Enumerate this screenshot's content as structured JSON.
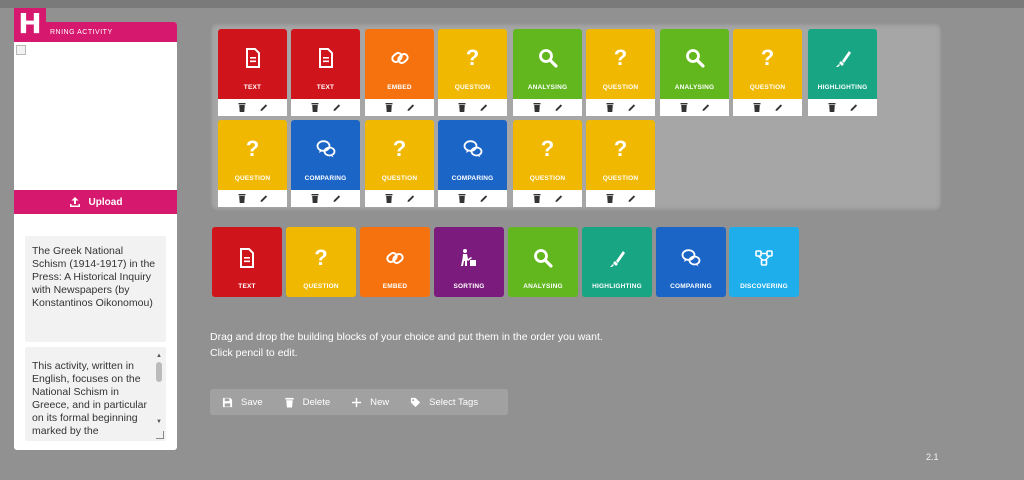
{
  "app": {
    "logo_letter": "H",
    "header_text": "RNING ACTIVITY",
    "version": "2.1"
  },
  "upload": {
    "label": "Upload"
  },
  "activity": {
    "title": "The Greek National Schism (1914-1917) in the Press: A Historical Inquiry with Newspapers (by Konstantinos Oikonomou)",
    "description": "This activity, written in English, focuses on the National Schism in Greece, and in particular on its formal beginning marked by the"
  },
  "sequence": [
    {
      "type": "TEXT",
      "color": "red",
      "icon": "document-icon"
    },
    {
      "type": "TEXT",
      "color": "red",
      "icon": "document-icon"
    },
    {
      "type": "EMBED",
      "color": "orange",
      "icon": "link-icon"
    },
    {
      "type": "QUESTION",
      "color": "yellow",
      "icon": "question-icon"
    },
    {
      "type": "ANALYSING",
      "color": "green",
      "icon": "magnifier-icon"
    },
    {
      "type": "QUESTION",
      "color": "yellow",
      "icon": "question-icon"
    },
    {
      "type": "ANALYSING",
      "color": "green",
      "icon": "magnifier-icon"
    },
    {
      "type": "QUESTION",
      "color": "yellow",
      "icon": "question-icon"
    },
    {
      "type": "HIGHLIGHTING",
      "color": "teal",
      "icon": "highlighter-icon"
    },
    {
      "type": "QUESTION",
      "color": "yellow",
      "icon": "question-icon"
    },
    {
      "type": "COMPARING",
      "color": "blue",
      "icon": "speech-bubbles-icon"
    },
    {
      "type": "QUESTION",
      "color": "yellow",
      "icon": "question-icon"
    },
    {
      "type": "COMPARING",
      "color": "blue",
      "icon": "speech-bubbles-icon"
    },
    {
      "type": "QUESTION",
      "color": "yellow",
      "icon": "question-icon"
    },
    {
      "type": "QUESTION",
      "color": "yellow",
      "icon": "question-icon"
    }
  ],
  "palette": [
    {
      "type": "TEXT",
      "color": "red",
      "icon": "document-icon"
    },
    {
      "type": "QUESTION",
      "color": "yellow",
      "icon": "question-icon"
    },
    {
      "type": "EMBED",
      "color": "orange",
      "icon": "link-icon"
    },
    {
      "type": "SORTING",
      "color": "purple",
      "icon": "sorting-icon"
    },
    {
      "type": "ANALYSING",
      "color": "green",
      "icon": "magnifier-icon"
    },
    {
      "type": "HIGHLIGHTING",
      "color": "teal",
      "icon": "highlighter-icon"
    },
    {
      "type": "COMPARING",
      "color": "blue",
      "icon": "speech-bubbles-icon"
    },
    {
      "type": "DISCOVERING",
      "color": "cyan",
      "icon": "nodes-icon"
    }
  ],
  "instructions": {
    "line1": "Drag and drop the building blocks of your choice and put them in the order you want.",
    "line2": "Click pencil to edit."
  },
  "toolbar": {
    "save": "Save",
    "delete": "Delete",
    "new": "New",
    "tags": "Select Tags"
  },
  "colors": {
    "brand": "#d6196f",
    "background": "#919191"
  }
}
